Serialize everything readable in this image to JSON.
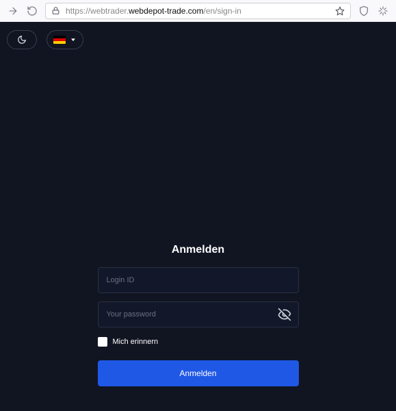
{
  "browser": {
    "url_protocol": "https://",
    "url_subdomain": "webtrader.",
    "url_host": "webdepot-trade.com",
    "url_path": "/en/sign-in"
  },
  "toolbar": {
    "theme_icon": "moon-icon",
    "language_flag": {
      "top": "#000000",
      "mid": "#dd0000",
      "bot": "#ffce00"
    }
  },
  "login": {
    "title": "Anmelden",
    "login_placeholder": "Login ID",
    "login_value": "",
    "password_placeholder": "Your password",
    "password_value": "",
    "remember_label": "Mich erinnern",
    "remember_checked": false,
    "submit_label": "Anmelden"
  },
  "colors": {
    "page_bg": "#111522",
    "accent": "#2058e6"
  }
}
